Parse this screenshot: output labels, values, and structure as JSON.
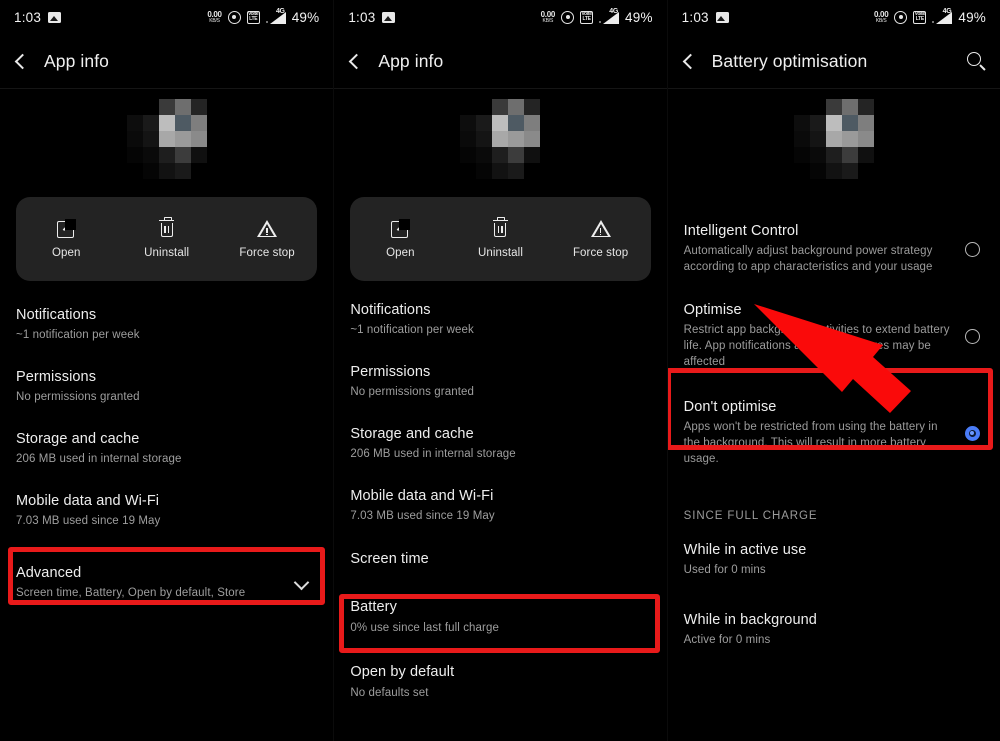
{
  "status_bar": {
    "time": "1:03",
    "icons_left": [
      "screenshot-icon"
    ],
    "data_rate_value": "0.00",
    "data_rate_unit": "KB/S",
    "icons_right": [
      "location-icon",
      "volte-icon",
      "signal-4g-icon"
    ],
    "volte_top": "Volte",
    "volte_bottom": "LTE",
    "network_type": "4G",
    "battery": "49%"
  },
  "panel1": {
    "title": "App info",
    "actions": [
      {
        "label": "Open",
        "icon": "open-external-icon"
      },
      {
        "label": "Uninstall",
        "icon": "trash-icon"
      },
      {
        "label": "Force stop",
        "icon": "warning-triangle-icon"
      }
    ],
    "rows": [
      {
        "title": "Notifications",
        "sub": "~1 notification per week"
      },
      {
        "title": "Permissions",
        "sub": "No permissions granted"
      },
      {
        "title": "Storage and cache",
        "sub": "206 MB used in internal storage"
      },
      {
        "title": "Mobile data and Wi-Fi",
        "sub": "7.03 MB used since 19 May"
      },
      {
        "title": "Advanced",
        "sub": "Screen time, Battery, Open by default, Store",
        "chevron": "chevron-down-icon",
        "highlighted": true
      }
    ]
  },
  "panel2": {
    "title": "App info",
    "actions": [
      {
        "label": "Open",
        "icon": "open-external-icon"
      },
      {
        "label": "Uninstall",
        "icon": "trash-icon"
      },
      {
        "label": "Force stop",
        "icon": "warning-triangle-icon"
      }
    ],
    "rows": [
      {
        "title": "Notifications",
        "sub": "~1 notification per week"
      },
      {
        "title": "Permissions",
        "sub": "No permissions granted"
      },
      {
        "title": "Storage and cache",
        "sub": "206 MB used in internal storage"
      },
      {
        "title": "Mobile data and Wi-Fi",
        "sub": "7.03 MB used since 19 May"
      },
      {
        "title": "Screen time",
        "sub": ""
      },
      {
        "title": "Battery",
        "sub": "0% use since last full charge",
        "highlighted": true
      },
      {
        "title": "Open by default",
        "sub": "No defaults set"
      }
    ]
  },
  "panel3": {
    "title": "Battery optimisation",
    "search_icon": "search-icon",
    "options": [
      {
        "title": "Intelligent Control",
        "sub": "Automatically adjust background power strategy according to app characteristics and your usage",
        "selected": false
      },
      {
        "title": "Optimise",
        "sub": "Restrict app background activities to extend battery life. App notifications and other features may be affected",
        "selected": false
      },
      {
        "title": "Don't optimise",
        "sub": "Apps won't be restricted from using the battery in the background. This will result in more battery usage.",
        "selected": true,
        "highlighted": true
      }
    ],
    "section_label": "SINCE FULL CHARGE",
    "usage_rows": [
      {
        "title": "While in active use",
        "sub": "Used for 0 mins"
      },
      {
        "title": "While in background",
        "sub": "Active for 0 mins"
      }
    ]
  },
  "annotations": {
    "highlight_color": "#e81a1a",
    "arrow_color": "#fa0a0a",
    "accent_color": "#4a7cf7"
  }
}
